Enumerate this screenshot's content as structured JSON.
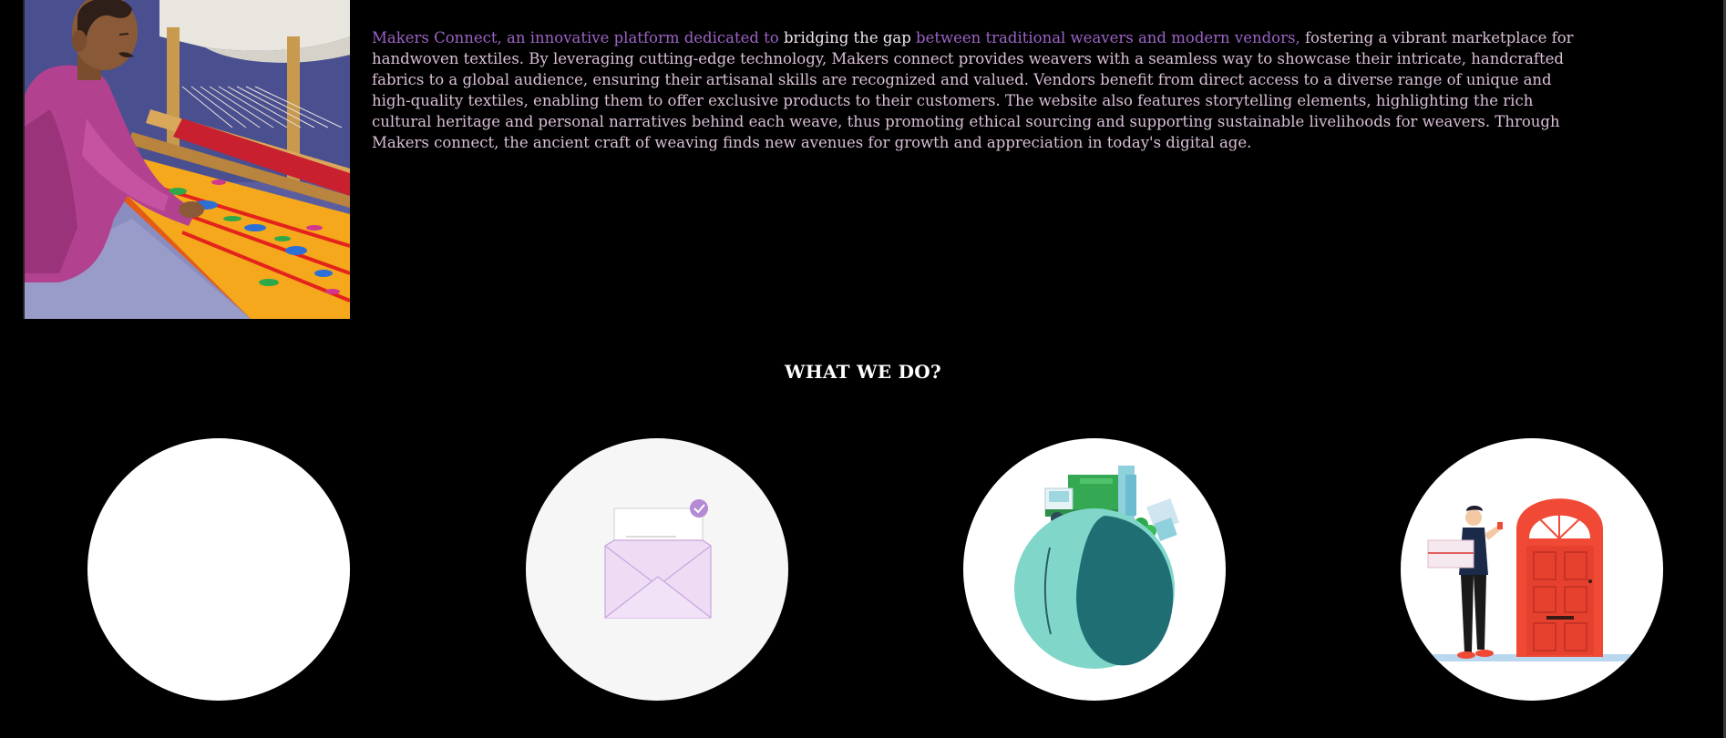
{
  "hero": {
    "image": "weaver-at-loom-illustration"
  },
  "intro": {
    "segments": [
      {
        "text": "Makers Connect, an innovative platform dedicated to ",
        "style": "hl"
      },
      {
        "text": "bridging the gap ",
        "style": "wh"
      },
      {
        "text": "between traditional weavers and modern vendors, ",
        "style": "hl"
      },
      {
        "text": "fostering a vibrant marketplace for handwoven textiles. By leveraging cutting-edge technology, Makers connect provides weavers with a seamless way to showcase their intricate, handcrafted fabrics to a global audience, ensuring their artisanal skills are recognized and valued. Vendors benefit from direct access to a diverse range of unique and high-quality textiles, enabling them to offer exclusive products to their customers. The website also features storytelling elements, highlighting the rich cultural heritage and personal narratives behind each weave, thus promoting ethical sourcing and supporting sustainable livelihoods for weavers. Through Makers connect, the ancient craft of weaving finds new avenues for growth and appreciation in today's digital age.",
        "style": "pl"
      }
    ]
  },
  "what_we_do": {
    "heading": "WHAT WE DO?",
    "items": [
      {
        "icon": "blank-circle-image"
      },
      {
        "icon": "envelope-with-check-icon"
      },
      {
        "icon": "globe-delivery-truck-icon"
      },
      {
        "icon": "doorstep-delivery-icon"
      }
    ]
  },
  "colors": {
    "background": "#000000",
    "accent_purple": "#9c63c6",
    "text_pink": "#d9bfd6",
    "door_red": "#f04a36",
    "globe_teal": "#7fd6c9"
  }
}
